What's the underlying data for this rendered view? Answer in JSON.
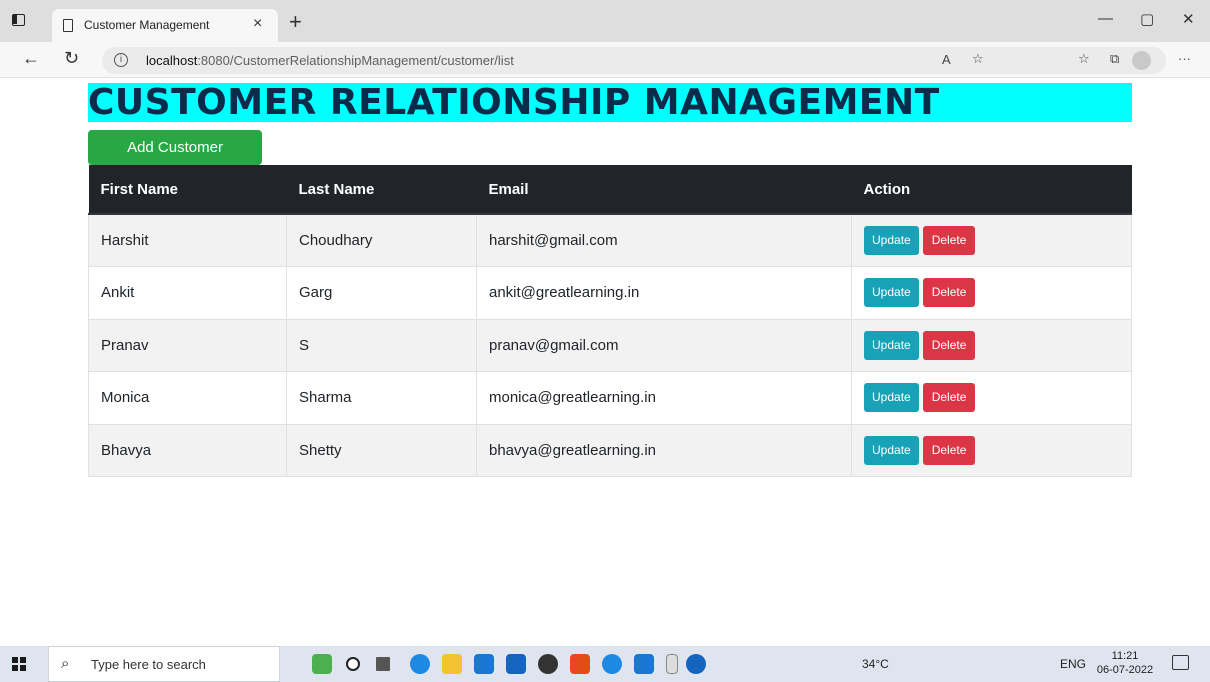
{
  "browser": {
    "tab_title": "Customer Management",
    "tab_close": "×",
    "new_tab": "+",
    "url_host": "localhost",
    "url_rest": ":8080/CustomerRelationshipManagement/customer/list",
    "controls": {
      "minimize": "—",
      "restore": "▢",
      "close": "✕"
    },
    "nav": {
      "back": "←",
      "reload": "↻",
      "more": "···"
    }
  },
  "page": {
    "heading": "CUSTOMER RELATIONSHIP MANAGEMENT",
    "add_button": "Add Customer",
    "table": {
      "headers": [
        "First Name",
        "Last Name",
        "Email",
        "Action"
      ],
      "rows": [
        {
          "first": "Harshit",
          "last": "Choudhary",
          "email": "harshit@gmail.com"
        },
        {
          "first": "Ankit",
          "last": "Garg",
          "email": "ankit@greatlearning.in"
        },
        {
          "first": "Pranav",
          "last": "S",
          "email": "pranav@gmail.com"
        },
        {
          "first": "Monica",
          "last": "Sharma",
          "email": "monica@greatlearning.in"
        },
        {
          "first": "Bhavya",
          "last": "Shetty",
          "email": "bhavya@greatlearning.in"
        }
      ],
      "update_label": "Update",
      "delete_label": "Delete"
    }
  },
  "taskbar": {
    "search_placeholder": "Type here to search",
    "weather": "34°C",
    "language": "ENG",
    "time": "11:21",
    "date": "06-07-2022"
  },
  "colors": {
    "heading_bg": "#00ffff",
    "add_button": "#28a745",
    "update_button": "#17a2b8",
    "delete_button": "#dc3545",
    "table_header": "#212529"
  }
}
